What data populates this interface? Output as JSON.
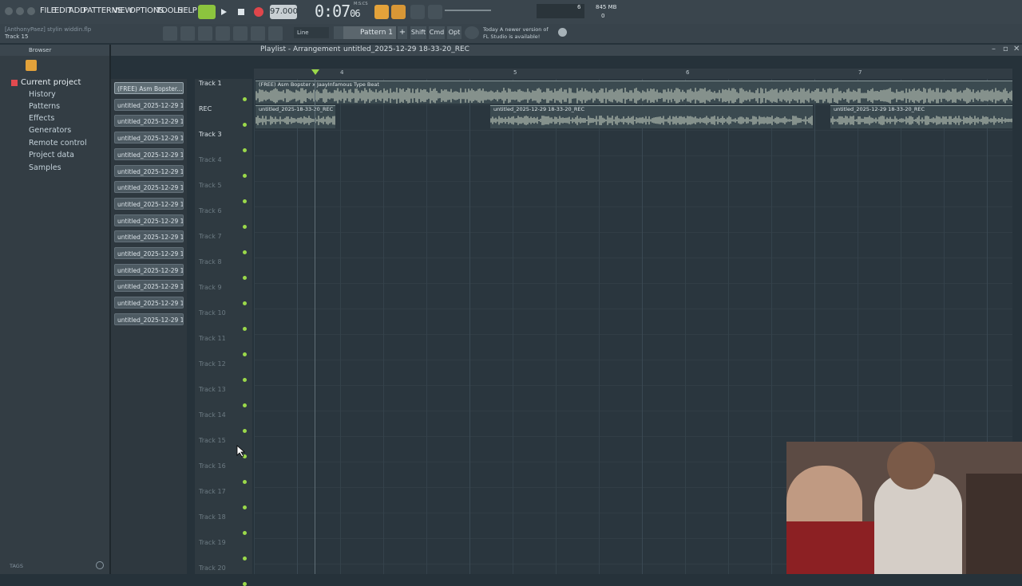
{
  "menu": [
    "FILE",
    "EDIT",
    "ADD",
    "PATTERNS",
    "VIEW",
    "OPTIONS",
    "TOOLS",
    "HELP"
  ],
  "transport": {
    "tempo": "97.000",
    "time_main": "0:07",
    "time_sub": "06",
    "time_label": "M:S:CS",
    "cpu": "6",
    "mem": "845 MB",
    "mem_sub": "0"
  },
  "project": {
    "author_line": "[AnthonyPaez] stylin widdin.flp",
    "hint": "Track 15",
    "snap": "Line",
    "pattern": "Pattern 1"
  },
  "keys": {
    "shift": "Shift",
    "cmd": "Cmd",
    "opt": "Opt"
  },
  "news": {
    "line1": "Today  A newer version of",
    "line2": "FL Studio is available!"
  },
  "browser": {
    "title": "Browser",
    "items": [
      "Current project",
      "History",
      "Patterns",
      "Effects",
      "Generators",
      "Remote control",
      "Project data",
      "Samples"
    ],
    "tags": "TAGS"
  },
  "playlist": {
    "title": "Playlist - Arrangement",
    "breadcrumb": "untitled_2025-12-29 18-33-20_REC"
  },
  "channels": [
    "(FREE) Asm Bopster...",
    "untitled_2025-12-29 18-...",
    "untitled_2025-12-29 18-...",
    "untitled_2025-12-29 18-...",
    "untitled_2025-12-29 18-...",
    "untitled_2025-12-29 18-...",
    "untitled_2025-12-29 18-...",
    "untitled_2025-12-29 18-...",
    "untitled_2025-12-29 18-...",
    "untitled_2025-12-29 18-...",
    "untitled_2025-12-29 18-...",
    "untitled_2025-12-29 18-...",
    "untitled_2025-12-29 18-...",
    "untitled_2025-12-29 18-...",
    "untitled_2025-12-29 18-..."
  ],
  "tracks": [
    "Track 1",
    "REC",
    "Track 3",
    "Track 4",
    "Track 5",
    "Track 6",
    "Track 7",
    "Track 8",
    "Track 9",
    "Track 10",
    "Track 11",
    "Track 12",
    "Track 13",
    "Track 14",
    "Track 15",
    "Track 16",
    "Track 17",
    "Track 18",
    "Track 19",
    "Track 20"
  ],
  "ruler": [
    "4",
    "5",
    "6",
    "7"
  ],
  "clips": {
    "beat": "(FREE) Asm Bopster x JaayInfamous Type Beat",
    "rec1": "untitled_2025-18-33-20_REC",
    "rec2": "untitled_2025-12-29 18-33-20_REC",
    "rec3": "untitled_2025-12-29 18-33-20_REC"
  }
}
